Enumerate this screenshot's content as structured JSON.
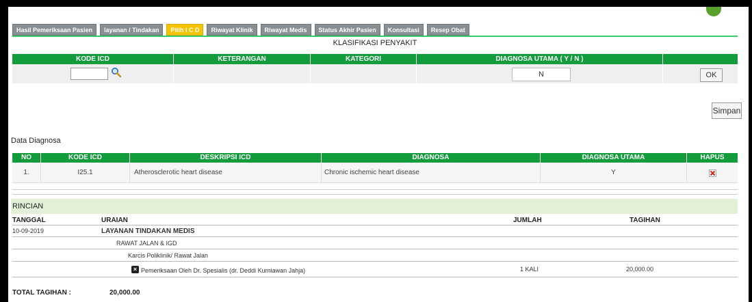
{
  "tabs": [
    "Hasil Pemeriksaan Pasien",
    "layanan / Tindakan",
    "Pilih I C D",
    "Riwayat Klinik",
    "Riwayat Medis",
    "Status Akhir Pasien",
    "Konsultasi",
    "Resep Obat"
  ],
  "klasifikasi": {
    "title": "KLASIFIKASI PENYAKIT",
    "headers": [
      "KODE ICD",
      "KETERANGAN",
      "KATEGORI",
      "DIAGNOSA UTAMA ( Y / N )"
    ],
    "kode_value": "",
    "diagnosa_utama_value": "N",
    "ok_label": "OK",
    "simpan_label": "Simpan"
  },
  "data_diagnosa": {
    "title": "Data Diagnosa",
    "headers": [
      "NO",
      "KODE ICD",
      "DESKRIPSI ICD",
      "DIAGNOSA",
      "DIAGNOSA UTAMA",
      "HAPUS"
    ],
    "rows": [
      {
        "no": "1.",
        "kode": "I25.1",
        "deskripsi": "Atherosclerotic heart disease",
        "diagnosa": "Chronic ischemic heart disease",
        "utama": "Y"
      }
    ]
  },
  "rincian": {
    "title": "RINCIAN",
    "headers": {
      "tanggal": "TANGGAL",
      "uraian": "URAIAN",
      "jumlah": "JUMLAH",
      "tagihan": "TAGIHAN"
    },
    "date": "10-09-2019",
    "layanan": "LAYANAN TINDAKAN MEDIS",
    "rawat": "RAWAT JALAN & IGD",
    "karcis": "Karcis Poliklinik/ Rawat Jalan",
    "item": "Pemeriksaan Oleh Dr. Spesialis (dr. Deddi Kurniawan Jahja)",
    "jumlah": "1 KALI",
    "tagihan": "20,000.00",
    "total_label": "TOTAL TAGIHAN :",
    "total_value": "20,000.00"
  },
  "colors": {
    "header_green": "#129c3b",
    "active_tab": "#f5c400",
    "tab_gray": "#8a8f94",
    "rincian_bg": "#e3f0d8"
  },
  "icons": {
    "search": "search-icon",
    "hapus": "delete-icon",
    "close": "close-icon"
  }
}
